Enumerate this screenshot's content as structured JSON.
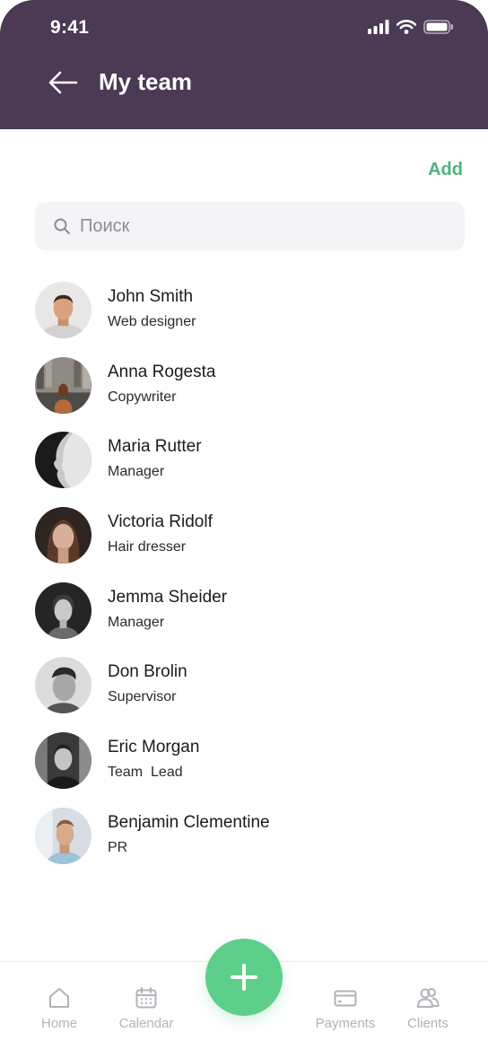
{
  "status_bar": {
    "time": "9:41"
  },
  "header": {
    "title": "My team"
  },
  "actions": {
    "add_label": "Add"
  },
  "search": {
    "placeholder": "Поиск"
  },
  "members": [
    {
      "name": "John Smith",
      "role": "Web designer"
    },
    {
      "name": "Anna Rogesta",
      "role": "Copywriter"
    },
    {
      "name": "Maria Rutter",
      "role": "Manager"
    },
    {
      "name": "Victoria Ridolf",
      "role": "Hair dresser"
    },
    {
      "name": "Jemma Sheider",
      "role": "Manager"
    },
    {
      "name": "Don Brolin",
      "role": "Supervisor"
    },
    {
      "name": "Eric Morgan",
      "role": "Team  Lead"
    },
    {
      "name": "Benjamin Clementine",
      "role": "PR"
    }
  ],
  "tabbar": {
    "tabs": [
      {
        "label": "Home",
        "icon": "home-icon"
      },
      {
        "label": "Calendar",
        "icon": "calendar-icon"
      },
      {
        "label": "Payments",
        "icon": "card-icon"
      },
      {
        "label": "Clients",
        "icon": "users-icon"
      }
    ]
  },
  "colors": {
    "header_bg": "#4a3a54",
    "accent_green": "#4fb37c",
    "fab_green": "#5dcf8b",
    "tab_inactive": "#b2b2ba"
  }
}
